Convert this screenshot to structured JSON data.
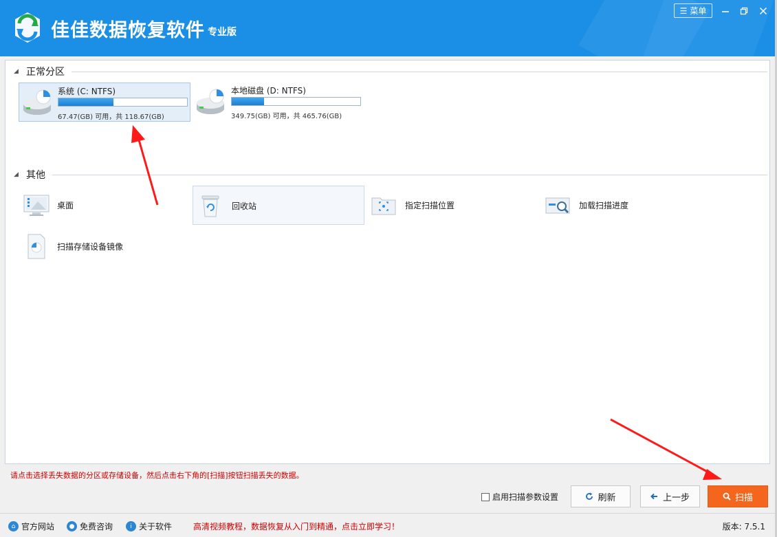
{
  "app": {
    "title": "佳佳数据恢复软件",
    "edition": "专业版",
    "menu_label": "菜单"
  },
  "sections": {
    "partitions_label": "正常分区",
    "other_label": "其他"
  },
  "drives": [
    {
      "name": "系统 (C: NTFS)",
      "info": "67.47(GB) 可用，共 118.67(GB)",
      "used_fraction": 0.43,
      "selected": true
    },
    {
      "name": "本地磁盘 (D: NTFS)",
      "info": "349.75(GB) 可用，共 465.76(GB)",
      "used_fraction": 0.25,
      "selected": false
    }
  ],
  "other_items": [
    {
      "label": "桌面",
      "icon": "desktop-icon"
    },
    {
      "label": "回收站",
      "icon": "recycle-bin-icon"
    },
    {
      "label": "指定扫描位置",
      "icon": "folder-scan-icon"
    },
    {
      "label": "加载扫描进度",
      "icon": "load-progress-icon"
    },
    {
      "label": "扫描存储设备镜像",
      "icon": "disk-image-icon"
    }
  ],
  "hint": "请点击选择丢失数据的分区或存储设备，然后点击右下角的[扫描]按钮扫描丢失的数据。",
  "actions": {
    "scan_params_label": "启用扫描参数设置",
    "refresh_label": "刷新",
    "back_label": "上一步",
    "scan_label": "扫描"
  },
  "statusbar": {
    "website": "官方网站",
    "consult": "免费咨询",
    "about": "关于软件",
    "promo": "高清视频教程，数据恢复从入门到精通，点击立即学习！",
    "version": "版本: 7.5.1"
  },
  "colors": {
    "titlebar": "#1b8fe6",
    "scan_button": "#f4661e",
    "hint_text": "#d00000",
    "annotation_arrow": "#ff1a1a"
  }
}
